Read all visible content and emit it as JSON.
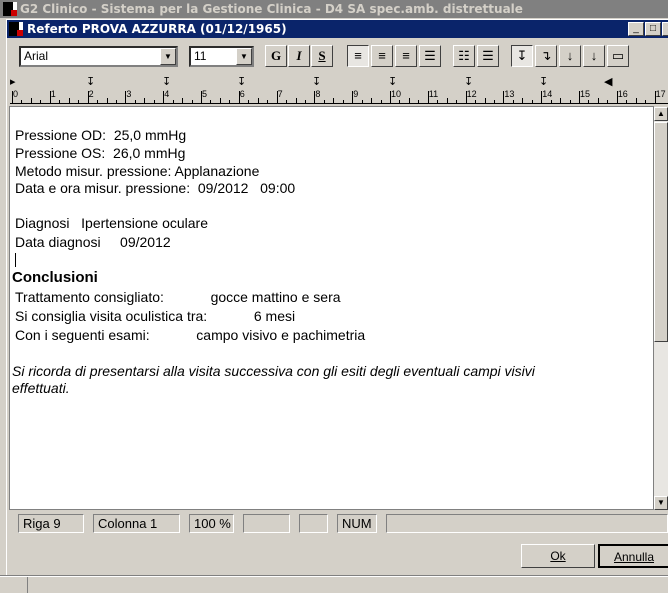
{
  "app_title": "G2 Clinico - Sistema per la Gestione Clinica - D4 SA spec.amb. distrettuale",
  "window_title": "Referto PROVA AZZURRA (01/12/1965)",
  "toolbar": {
    "font": "Arial",
    "size": "11",
    "bold": "G",
    "italic": "I",
    "strike": "S"
  },
  "ruler": [
    "0",
    "1",
    "2",
    "3",
    "4",
    "5",
    "6",
    "7",
    "8",
    "9",
    "10",
    "11",
    "12",
    "13",
    "14",
    "15",
    "16",
    "17"
  ],
  "document": {
    "lines": [
      "Pressione OD:  25,0 mmHg",
      "Pressione OS:  26,0 mmHg",
      "Metodo misur. pressione: Applanazione",
      "Data e ora misur. pressione:  09/2012   09:00",
      "Diagnosi   Ipertensione oculare",
      "Data diagnosi     09/2012"
    ],
    "heading": "Conclusioni",
    "conclusions": [
      "Trattamento consigliato:            gocce mattino e sera",
      "Si consiglia visita oculistica tra:            6 mesi",
      "Con i seguenti esami:            campo visivo e pachimetria"
    ],
    "note_1": "Si ricorda di presentarsi alla visita successiva con gli esiti degli eventuali campi visivi",
    "note_2": "effettuati."
  },
  "status": {
    "row": "Riga  9",
    "col": "Colonna  1",
    "zoom": "100 %",
    "num": "NUM"
  },
  "buttons": {
    "ok": "Ok",
    "cancel": "Annulla"
  }
}
